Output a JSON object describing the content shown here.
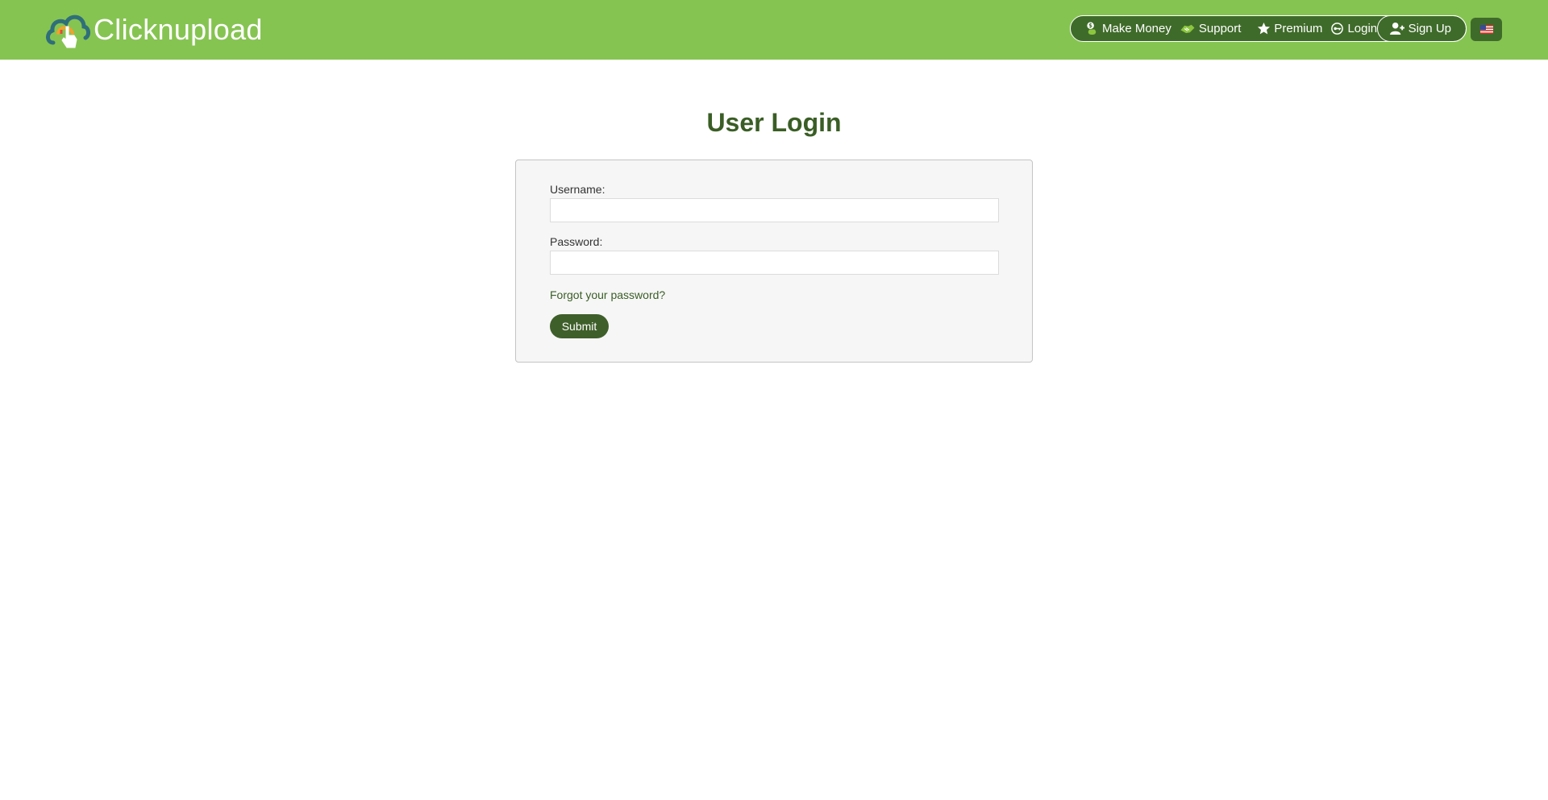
{
  "header": {
    "logo_text": "Clicknupload",
    "nav": {
      "make_money": "Make Money",
      "support": "Support",
      "premium": "Premium",
      "login": "Login",
      "signup": "Sign Up"
    },
    "language_flag": "us-flag-icon"
  },
  "main": {
    "title": "User Login",
    "form": {
      "username_label": "Username:",
      "username_value": "",
      "password_label": "Password:",
      "password_value": "",
      "forgot_link": "Forgot your password?",
      "submit_label": "Submit"
    }
  },
  "colors": {
    "header_bg": "#86c452",
    "nav_bg": "#3f6b2a",
    "title": "#3a5e25",
    "submit_bg": "#3f5f2a",
    "panel_bg": "#f6f6f6"
  }
}
